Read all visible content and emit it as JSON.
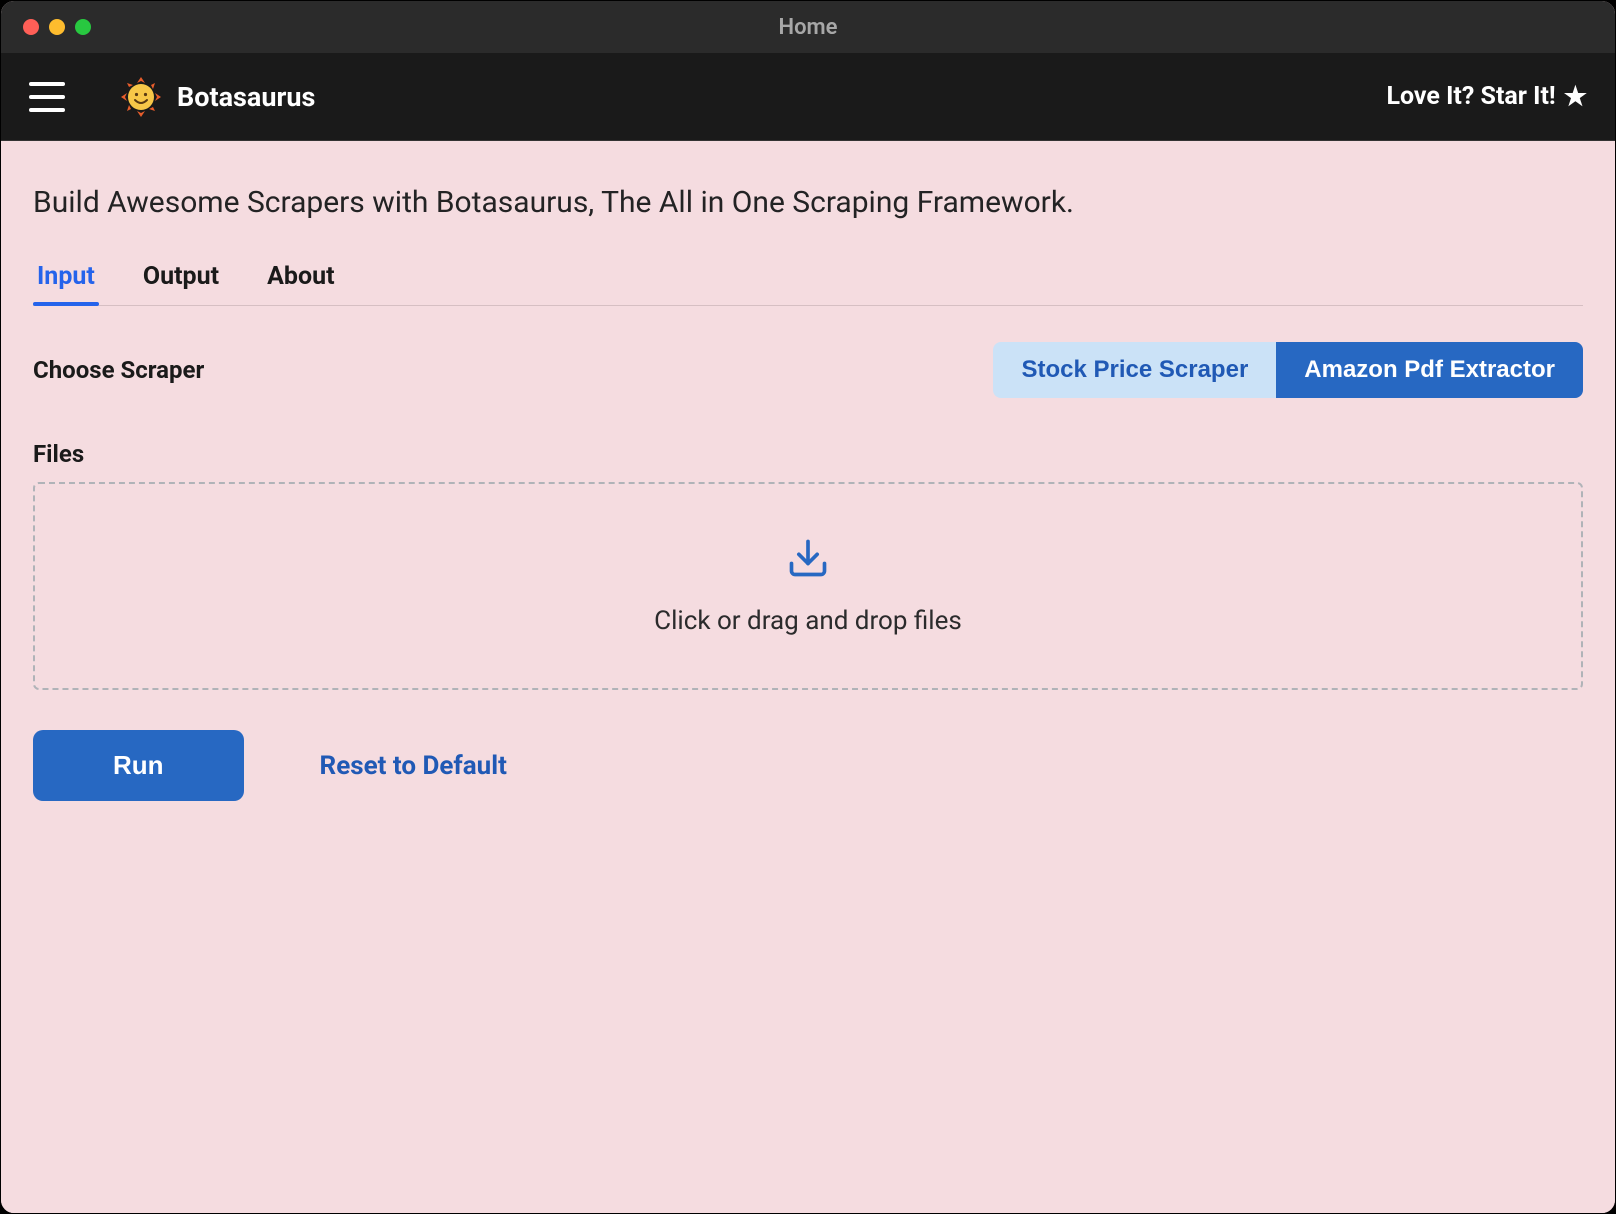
{
  "window": {
    "title": "Home"
  },
  "appbar": {
    "brand": "Botasaurus",
    "star_label": "Love It? Star It!"
  },
  "main": {
    "tagline": "Build Awesome Scrapers with Botasaurus, The All in One Scraping Framework.",
    "tabs": {
      "input": "Input",
      "output": "Output",
      "about": "About"
    },
    "choose_scraper_label": "Choose Scraper",
    "scrapers": {
      "stock": "Stock Price Scraper",
      "amazon": "Amazon Pdf Extractor"
    },
    "files_label": "Files",
    "dropzone_text": "Click or drag and drop files",
    "run_label": "Run",
    "reset_label": "Reset to Default"
  }
}
